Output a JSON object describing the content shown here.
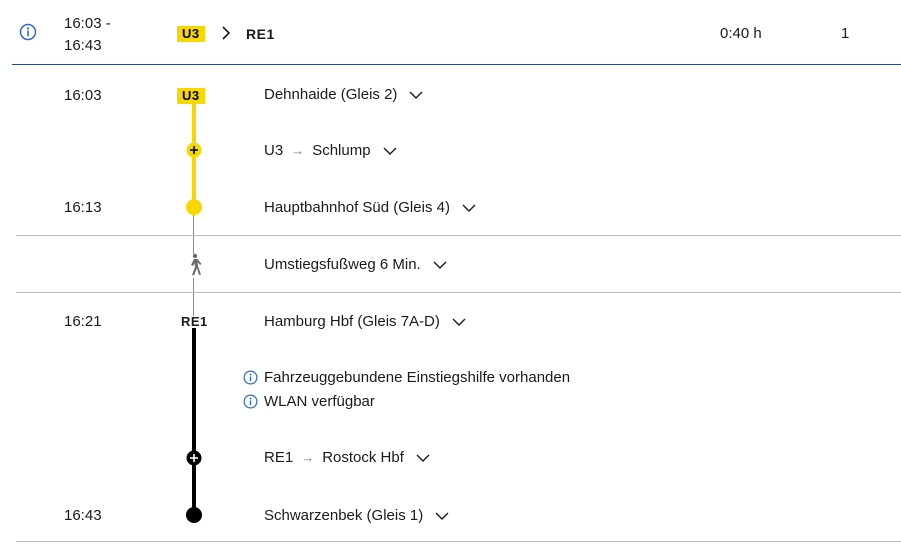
{
  "summary": {
    "time_start": "16:03 -",
    "time_end": "16:43",
    "first_line": "U3",
    "second_line": "RE1",
    "duration": "0:40 h",
    "changes": "1"
  },
  "legs": [
    {
      "line": "U3",
      "line_color": "#f6d800",
      "start_time": "16:03",
      "start_stop": "Dehnhaide (Gleis 2)",
      "direction_line": "U3",
      "direction": "Schlump",
      "end_time": "16:13",
      "end_stop": "Hauptbahnhof Süd (Gleis 4)"
    },
    {
      "line": "RE1",
      "line_color": "#000000",
      "start_time": "16:21",
      "start_stop": "Hamburg Hbf (Gleis 7A-D)",
      "notices": [
        "Fahrzeuggebundene Einstiegshilfe vorhanden",
        "WLAN verfügbar"
      ],
      "direction_line": "RE1",
      "direction": "Rostock Hbf",
      "end_time": "16:43",
      "end_stop": "Schwarzenbek (Gleis 1)"
    }
  ],
  "transfer": {
    "label": "Umstiegsfußweg 6 Min.",
    "icon": "walking-icon"
  },
  "colors": {
    "accent": "#2b6cc4",
    "summary_divider": "#2b4a84",
    "divider": "#bdbdbd",
    "u3_yellow": "#f6d800"
  }
}
